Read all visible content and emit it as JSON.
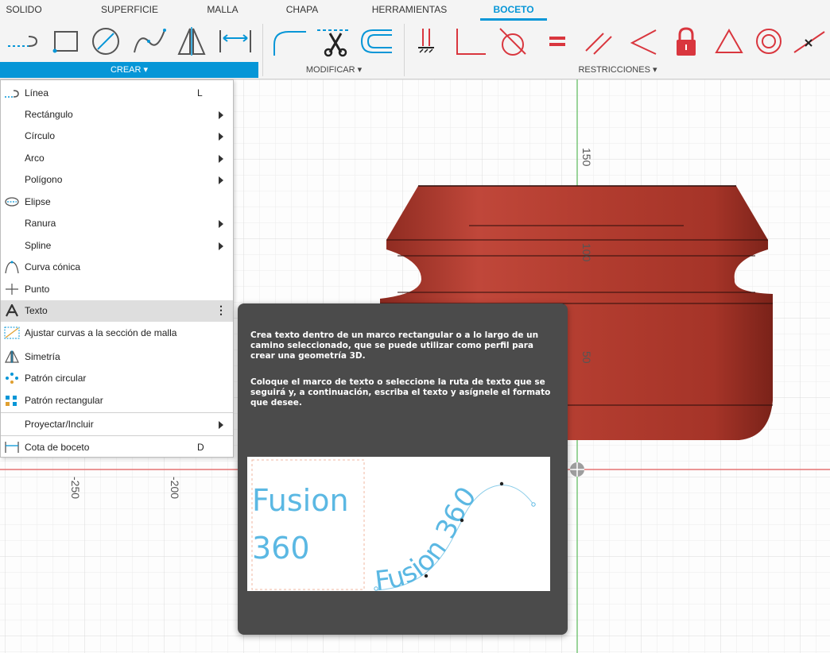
{
  "tabs": [
    "SOLIDO",
    "SUPERFICIE",
    "MALLA",
    "CHAPA",
    "HERRAMIENTAS",
    "BOCETO"
  ],
  "toolbar": {
    "groups": {
      "crear": "CREAR ▾",
      "modificar": "MODIFICAR ▾",
      "restricciones": "RESTRICCIONES ▾"
    }
  },
  "axis": {
    "v150": "150",
    "v100": "100",
    "v50": "50",
    "hm250": "-250",
    "hm200": "-200"
  },
  "menu": {
    "items": [
      {
        "label": "Línea",
        "shortcut": "L"
      },
      {
        "label": "Rectángulo"
      },
      {
        "label": "Círculo"
      },
      {
        "label": "Arco"
      },
      {
        "label": "Polígono"
      },
      {
        "label": "Elipse"
      },
      {
        "label": "Ranura"
      },
      {
        "label": "Spline"
      },
      {
        "label": "Curva cónica"
      },
      {
        "label": "Punto"
      },
      {
        "label": "Texto",
        "more": "⋮"
      },
      {
        "label": "Ajustar curvas a la sección de malla"
      },
      {
        "label": "Simetría"
      },
      {
        "label": "Patrón circular"
      },
      {
        "label": "Patrón rectangular"
      },
      {
        "label": "Proyectar/Incluir"
      },
      {
        "label": "Cota de boceto",
        "shortcut": "D"
      }
    ]
  },
  "tooltip": {
    "para1": "Crea texto dentro de un marco rectangular o a lo largo de un camino seleccionado, que se puede utilizar como perfil para crear una geometría 3D.",
    "para2": "Coloque el marco de texto o seleccione la ruta de texto que se seguirá y, a continuación, escriba el texto y asígnele el formato que desee.",
    "image": {
      "frame_line1": "Fusion",
      "frame_line2": "360",
      "path_text": "Fusion 360"
    }
  },
  "colors": {
    "accent": "#0696d7",
    "constraint_red": "#d9363e",
    "model_red": "#b03a2e",
    "tooltip_bg": "#4b4b4b",
    "fusion_text": "#5bb8e3"
  }
}
